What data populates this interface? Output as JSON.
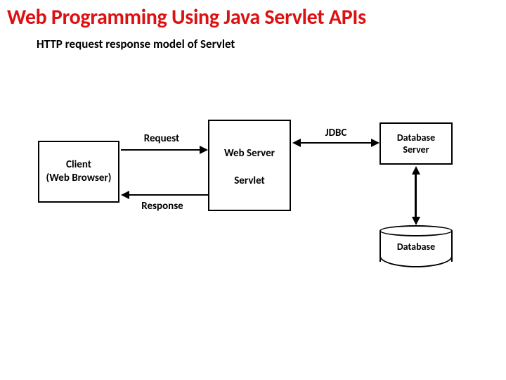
{
  "title": "Web Programming Using Java Servlet APIs",
  "subtitle": "HTTP request response model of Servlet",
  "nodes": {
    "client_line1": "Client",
    "client_line2": "(Web Browser)",
    "webserver_line1": "Web Server",
    "webserver_line2": "Servlet",
    "dbserver_line1": "Database",
    "dbserver_line2": "Server",
    "database": "Database"
  },
  "edges": {
    "request": "Request",
    "response": "Response",
    "jdbc": "JDBC"
  }
}
